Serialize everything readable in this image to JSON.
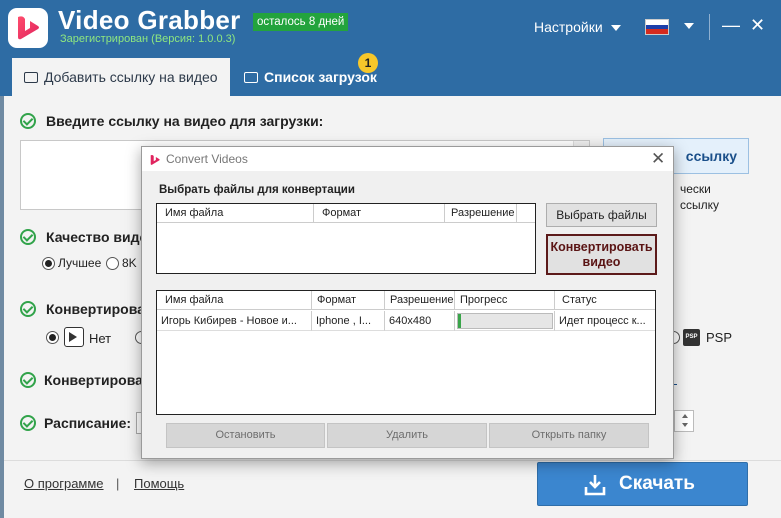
{
  "app": {
    "title": "Video Grabber",
    "trial_badge": "осталось 8 дней",
    "registration": "Зарегистрирован (Версия: 1.0.0.3)",
    "settings_label": "Настройки",
    "brand_color": "#2e6ca4",
    "accent_color": "#3b86cf",
    "check_color": "#31a34a"
  },
  "tabs": [
    {
      "label": "Добавить ссылку на видео",
      "icon": "video-add-icon",
      "active": true
    },
    {
      "label": "Список загрузок",
      "icon": "download-list-icon",
      "active": false,
      "badge": "1"
    }
  ],
  "main": {
    "url_section_label": "Введите ссылку на видео для загрузки:",
    "paste_button": "ссылку",
    "side_line1": "чески",
    "side_line2": "ссылку",
    "quality_label": "Качество виде",
    "quality_best": "Лучшее",
    "quality_8k": "8K",
    "convert_label": "Конвертироват",
    "convert_none": "Нет",
    "psp_label": "PSP",
    "convert2_label": "Конвертироват",
    "schedule_label": "Расписание:"
  },
  "footer": {
    "about": "О программе",
    "separator": "|",
    "help": "Помощь",
    "download_button": "Скачать"
  },
  "dialog": {
    "title": "Convert Videos",
    "heading": "Выбрать файлы для конвертации",
    "select_files_button": "Выбрать файлы",
    "convert_button": "Конвертировать видео",
    "files_table": {
      "columns": [
        "Имя файла",
        "Формат",
        "Разрешение"
      ]
    },
    "progress_table": {
      "columns": [
        "Имя файла",
        "Формат",
        "Разрешение",
        "Прогресс",
        "Статус"
      ],
      "rows": [
        {
          "name": "Игорь Кибирев  - Новое и...",
          "format": "Iphone , I...",
          "resolution": "640x480",
          "progress": 0.02,
          "status": "Идет процесс к..."
        }
      ]
    },
    "stop_button": "Остановить",
    "delete_button": "Удалить",
    "open_folder_button": "Открыть папку"
  }
}
